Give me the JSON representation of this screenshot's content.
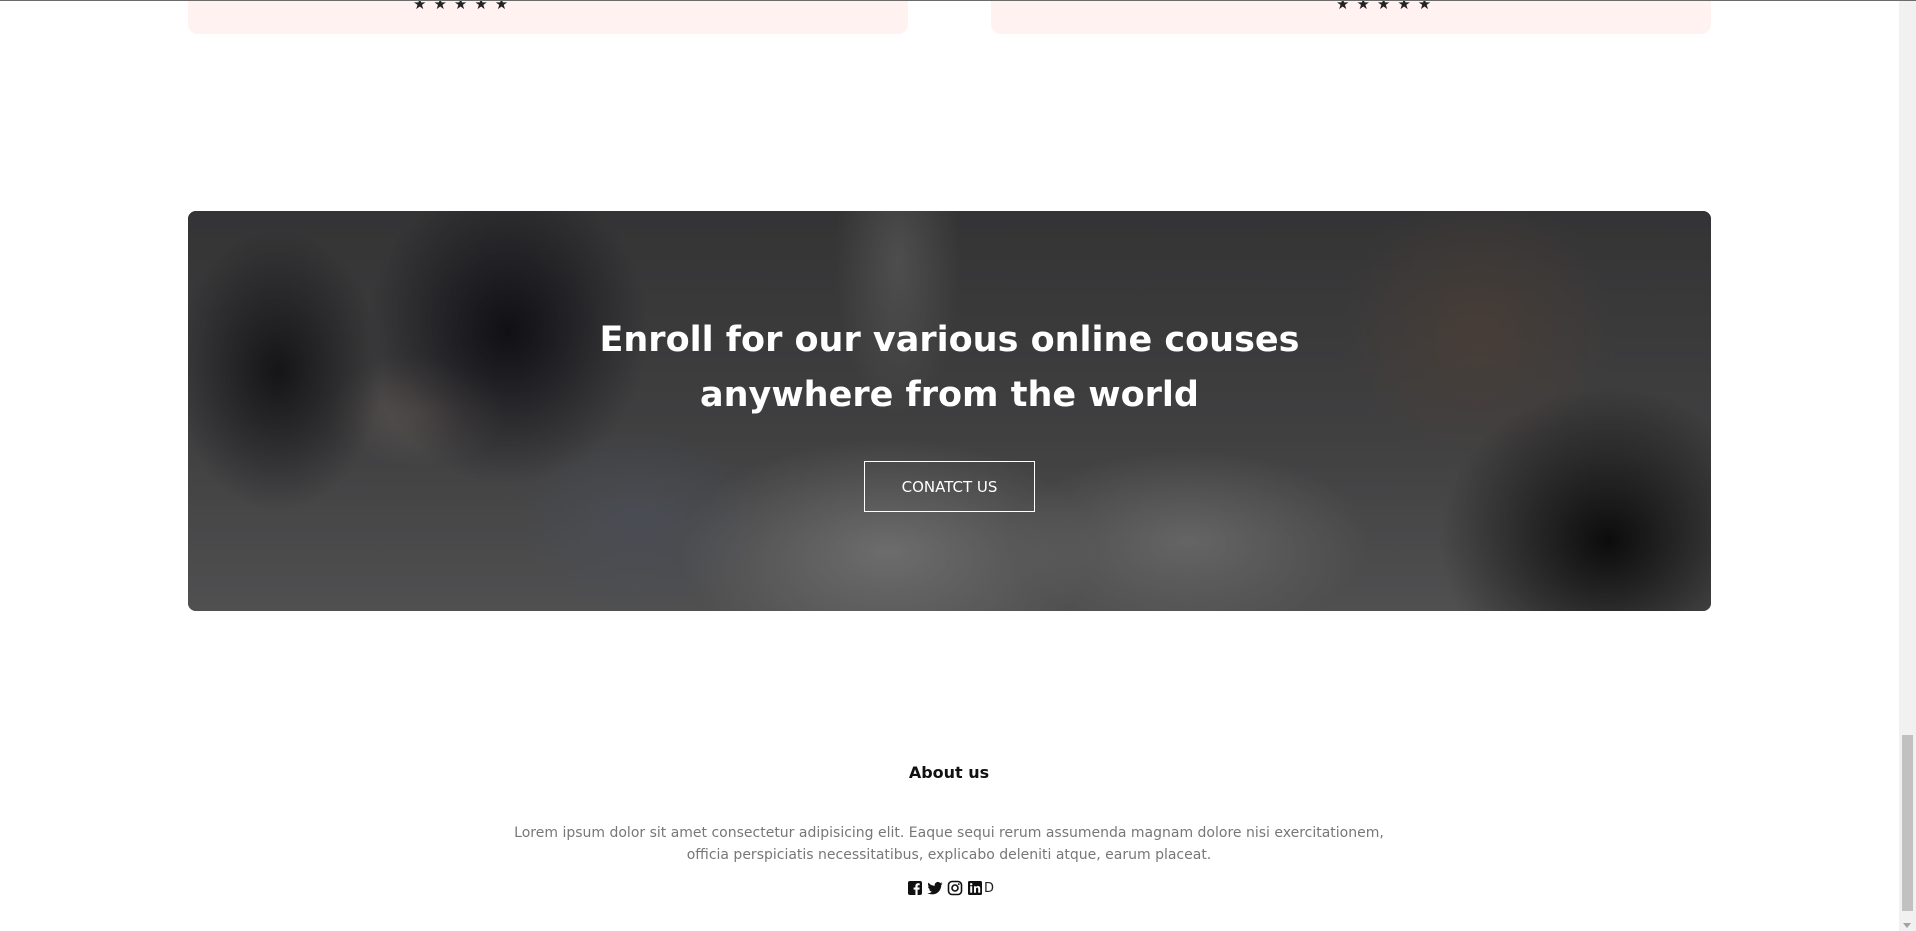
{
  "testimonials": {
    "left_stars": "★★★★★",
    "right_stars": "★★★★★"
  },
  "banner": {
    "heading_line1": "Enroll for our various online couses",
    "heading_line2": "anywhere from the world",
    "button_label": "CONATCT US"
  },
  "footer": {
    "about_title": "About us",
    "about_text_line1": "Lorem ipsum dolor sit amet consectetur adipisicing elit. Eaque sequi rerum assumenda magnam dolore nisi exercitationem,",
    "about_text_line2": "officia perspiciatis necessitatibus, explicabo deleniti atque, earum placeat.",
    "socials": [
      "facebook-icon",
      "twitter-icon",
      "instagram-icon",
      "linkedin-icon"
    ],
    "trailing_glyph": "D"
  },
  "colors": {
    "card_bg": "#fff2f1",
    "text_dark": "#111111",
    "text_muted": "#777777",
    "overlay": "#000000"
  }
}
